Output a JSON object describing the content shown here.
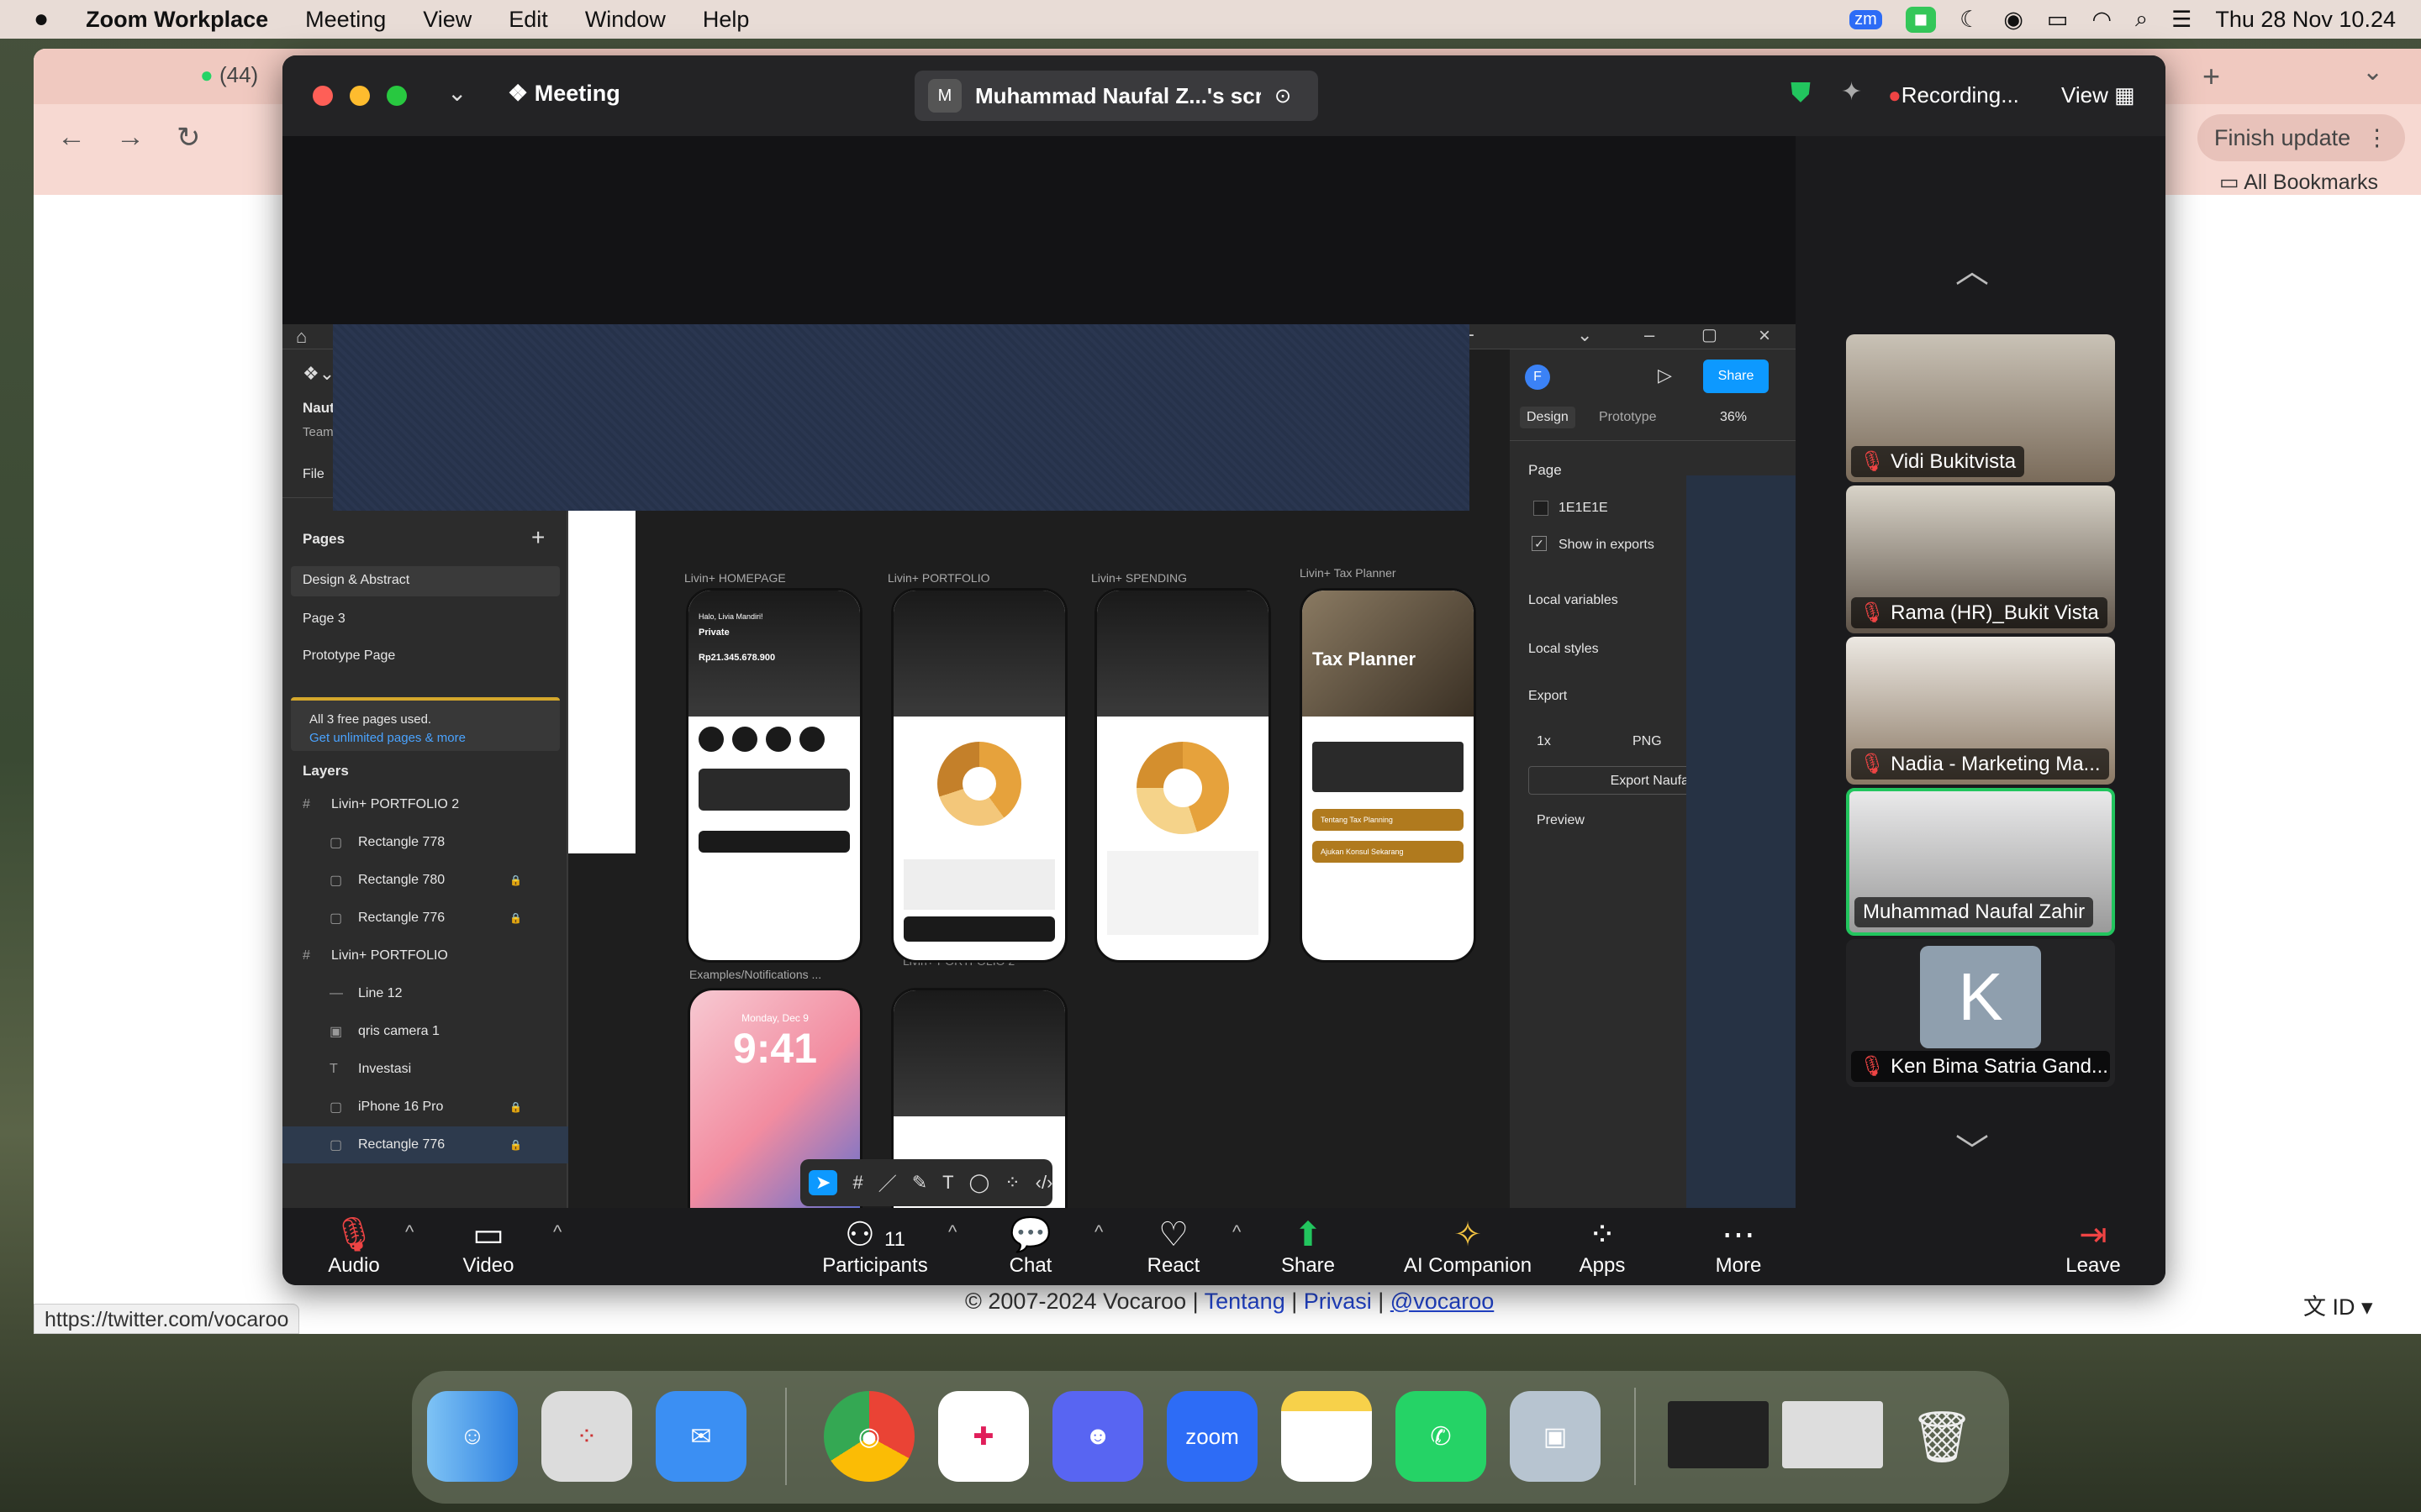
{
  "menubar": {
    "apple_icon": "apple-icon",
    "app_name": "Zoom Workplace",
    "items": [
      "Meeting",
      "View",
      "Edit",
      "Window",
      "Help"
    ],
    "datetime": "Thu 28 Nov  10.24"
  },
  "browser": {
    "tab_title": "(44)",
    "finish_update": "Finish update",
    "bookmarks": "All Bookmarks",
    "status_url": "https://twitter.com/vocaroo",
    "footer": {
      "copyright": "© 2007-2024 Vocaroo | ",
      "link1": "Tentang",
      "sep1": " | ",
      "link2": "Privasi",
      "sep2": " | ",
      "link3": "@vocaroo"
    },
    "lang": "ID"
  },
  "zoom": {
    "title": "Meeting",
    "share_title": "Muhammad Naufal Z...'s scre",
    "share_initial": "M",
    "recording": "Recording...",
    "view": "View",
    "toolbar": {
      "audio": "Audio",
      "video": "Video",
      "participants": "Participants",
      "participants_count": "11",
      "chat": "Chat",
      "react": "React",
      "share": "Share",
      "ai": "AI Companion",
      "apps": "Apps",
      "more": "More",
      "leave": "Leave"
    },
    "participants": [
      {
        "name": "Vidi Bukitvista"
      },
      {
        "name": "Rama (HR)_Bukit Vista"
      },
      {
        "name": "Nadia - Marketing Ma..."
      },
      {
        "name": "Muhammad Naufal Zahir"
      },
      {
        "name": "Ken Bima Satria Gand...",
        "initial": "K"
      }
    ]
  },
  "figma": {
    "team_short": "Naut",
    "team_sub": "Team",
    "file_tab": "File",
    "pages_label": "Pages",
    "pages": [
      "Design & Abstract",
      "Page 3",
      "Prototype Page"
    ],
    "free_pages": "All 3 free pages used.",
    "free_pages_link": "Get unlimited pages & more",
    "layers_label": "Layers",
    "layers": [
      {
        "name": "Livin+ PORTFOLIO 2",
        "type": "frame"
      },
      {
        "name": "Rectangle 778",
        "type": "rect"
      },
      {
        "name": "Rectangle 780",
        "type": "rect",
        "locked": true
      },
      {
        "name": "Rectangle 776",
        "type": "rect",
        "locked": true
      },
      {
        "name": "Livin+ PORTFOLIO",
        "type": "frame"
      },
      {
        "name": "Line 12",
        "type": "line"
      },
      {
        "name": "qris camera 1",
        "type": "image"
      },
      {
        "name": "Investasi",
        "type": "text"
      },
      {
        "name": "iPhone 16 Pro",
        "type": "rect",
        "locked": true
      },
      {
        "name": "Rectangle 776",
        "type": "rect",
        "locked": true
      }
    ],
    "frame_labels": [
      "Livin+ HOMEPAGE",
      "Livin+ PORTFOLIO",
      "Livin+ SPENDING",
      "Livin+ Tax Planner",
      "Examples/Notifications ...",
      "Livin+ PORTFOLIO 2"
    ],
    "phone": {
      "greeting": "Halo, Livia Mandiri!",
      "account": "Private",
      "balance": "Rp21.345.678.900",
      "tax_title": "Tax Planner",
      "tax_btn1": "Tentang Tax Planning",
      "tax_btn2": "Ajukan Konsul Sekarang",
      "lock_time": "9:41",
      "lock_date": "Monday, Dec 9"
    },
    "right": {
      "avatar": "F",
      "share": "Share",
      "tab_design": "Design",
      "tab_prototype": "Prototype",
      "zoom": "36%",
      "page_label": "Page",
      "bg_color": "1E1E1E",
      "show_exports": "Show in exports",
      "local_vars": "Local variables",
      "local_styles": "Local styles",
      "export": "Export",
      "scale": "1x",
      "format": "PNG",
      "export_btn": "Export Naufa",
      "preview": "Preview"
    }
  },
  "dock": {
    "zoom_label": "zoom"
  }
}
